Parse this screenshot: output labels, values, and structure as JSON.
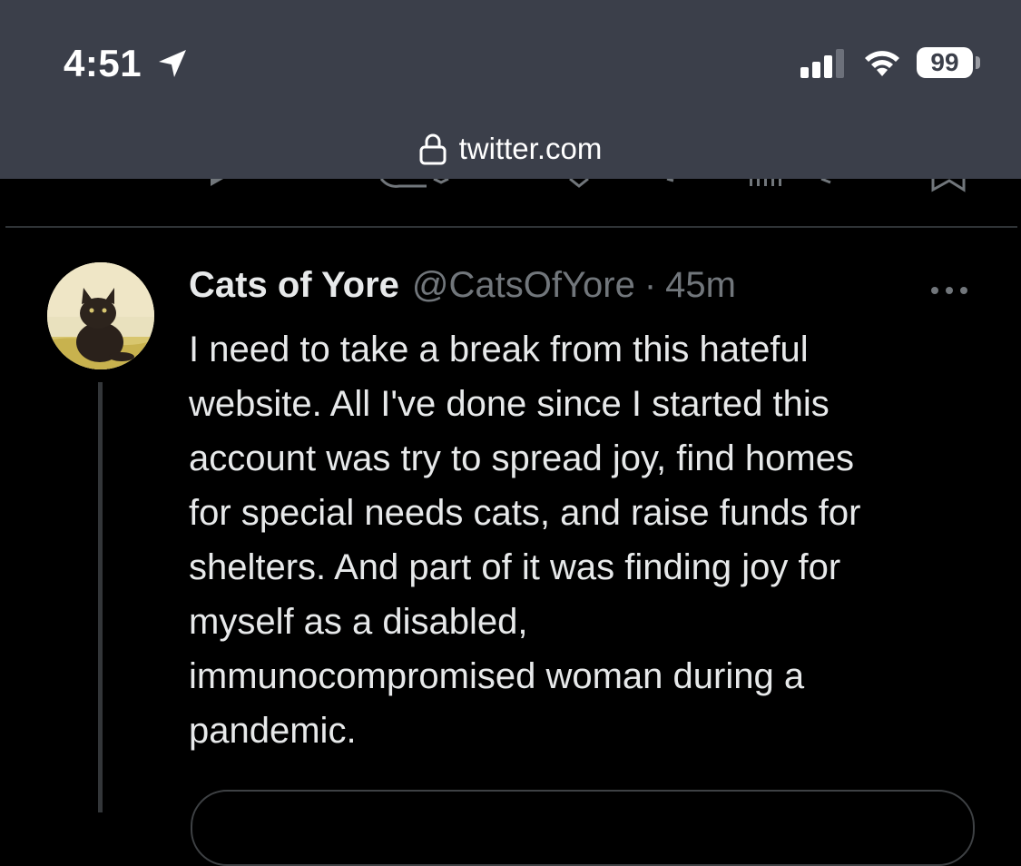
{
  "status_bar": {
    "time": "4:51",
    "battery": "99",
    "icons": [
      "location-arrow-icon",
      "cellular-signal-icon",
      "wifi-icon",
      "battery-icon"
    ]
  },
  "browser": {
    "url": "twitter.com",
    "lock_icon": "lock-icon"
  },
  "tweet": {
    "display_name": "Cats of Yore",
    "handle": "@CatsOfYore",
    "separator": "·",
    "time_ago": "45m",
    "text_lines": [
      "I need to take a break from this hateful",
      "website. All I've done since I started this",
      "account was try to spread joy, find homes",
      "for special needs cats, and raise funds for",
      "shelters. And part of it was finding joy for",
      "myself as a disabled,",
      "immunocompromised woman during a",
      "pandemic."
    ],
    "more_icon": "more-horizontal-icon"
  },
  "colors": {
    "background": "#000000",
    "top_bar": "#3b3f4a",
    "primary_text": "#e7e9ea",
    "secondary_text": "#71767b",
    "divider": "#2f3336"
  }
}
